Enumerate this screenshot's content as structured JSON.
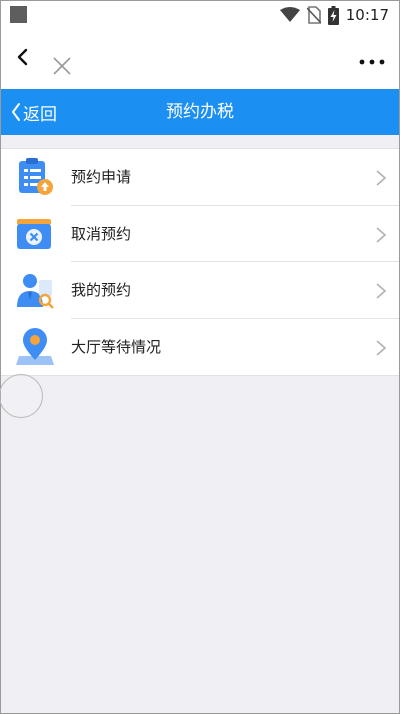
{
  "status_bar": {
    "time": "10:17"
  },
  "header": {
    "back_label": "返回",
    "title": "预约办税"
  },
  "menu": [
    {
      "label": "预约申请",
      "icon": "appointment-apply-icon"
    },
    {
      "label": "取消预约",
      "icon": "cancel-appointment-icon"
    },
    {
      "label": "我的预约",
      "icon": "my-appointment-icon"
    },
    {
      "label": "大厅等待情况",
      "icon": "hall-waiting-location-icon"
    }
  ],
  "colors": {
    "header_bg": "#1c8ff2",
    "page_bg": "#efeff4",
    "icon_blue": "#3d8df5",
    "icon_orange": "#f5a43a"
  }
}
